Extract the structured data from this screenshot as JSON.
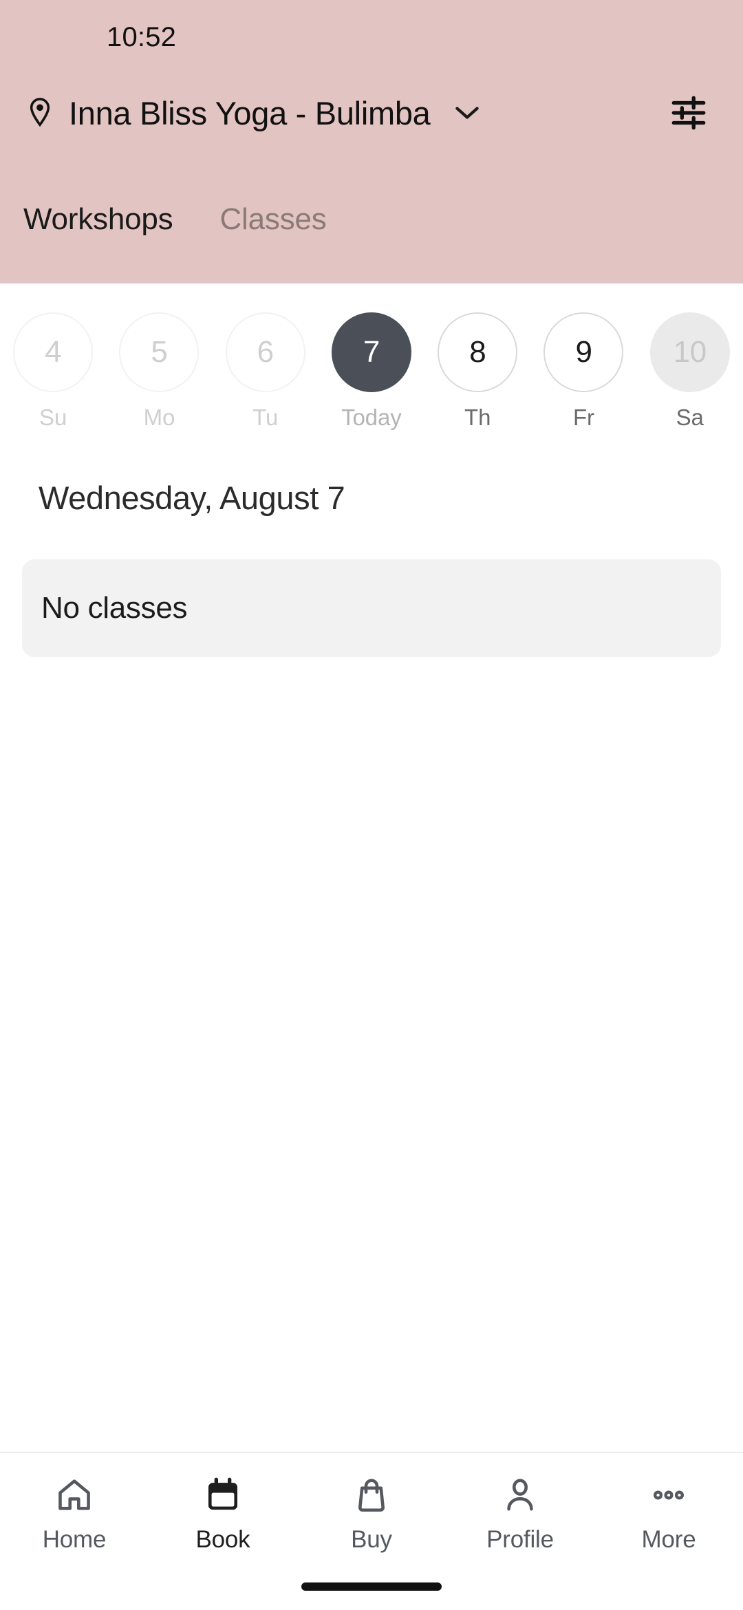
{
  "status_bar": {
    "time": "10:52"
  },
  "header": {
    "pin_icon": "location-pin-icon",
    "location_name": "Inna Bliss Yoga - Bulimba",
    "chevron_icon": "chevron-down-icon",
    "filter_icon": "filter-sliders-icon",
    "background_color": "#e2c4c2"
  },
  "tabs": [
    {
      "label": "Workshops",
      "active": true
    },
    {
      "label": "Classes",
      "active": false
    }
  ],
  "date_strip": {
    "days": [
      {
        "number": "4",
        "weekday": "Su",
        "state": "past"
      },
      {
        "number": "5",
        "weekday": "Mo",
        "state": "past"
      },
      {
        "number": "6",
        "weekday": "Tu",
        "state": "past"
      },
      {
        "number": "7",
        "weekday": "Today",
        "state": "selected"
      },
      {
        "number": "8",
        "weekday": "Th",
        "state": "future"
      },
      {
        "number": "9",
        "weekday": "Fr",
        "state": "future"
      },
      {
        "number": "10",
        "weekday": "Sa",
        "state": "skeleton"
      }
    ],
    "selected_color": "#4b5058"
  },
  "main": {
    "date_heading": "Wednesday, August 7",
    "empty_state_text": "No classes",
    "empty_state_bg": "#f2f2f2"
  },
  "bottom_nav": {
    "items": [
      {
        "label": "Home",
        "icon": "home-icon",
        "active": false
      },
      {
        "label": "Book",
        "icon": "calendar-icon",
        "active": true
      },
      {
        "label": "Buy",
        "icon": "shopping-bag-icon",
        "active": false
      },
      {
        "label": "Profile",
        "icon": "person-icon",
        "active": false
      },
      {
        "label": "More",
        "icon": "ellipsis-icon",
        "active": false
      }
    ]
  }
}
